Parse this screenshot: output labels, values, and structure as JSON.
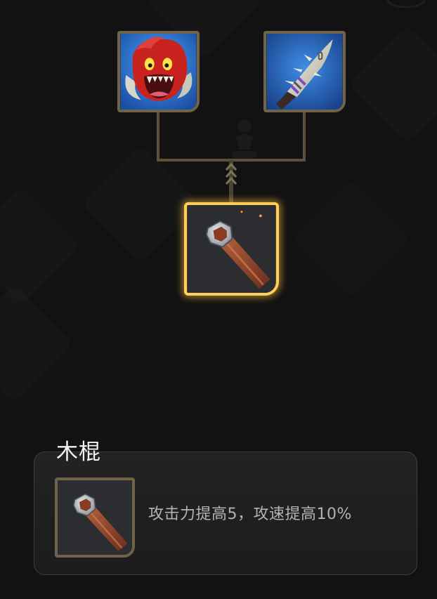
{
  "recipe_tree": {
    "components": [
      {
        "icon": "demon-monster-icon"
      },
      {
        "icon": "spiked-club-icon"
      }
    ],
    "result": {
      "icon": "wooden-stick-icon",
      "selected": true
    }
  },
  "detail": {
    "name": "木棍",
    "icon": "wooden-stick-icon",
    "description": "攻击力提高5，攻速提高10%"
  },
  "colors": {
    "background": "#121212",
    "slot_border": "#6f6449",
    "selected_glow": "#ffcf59",
    "connector": "#5b5237",
    "title_text": "#f2f2f2",
    "desc_text": "#b3b3b3"
  }
}
